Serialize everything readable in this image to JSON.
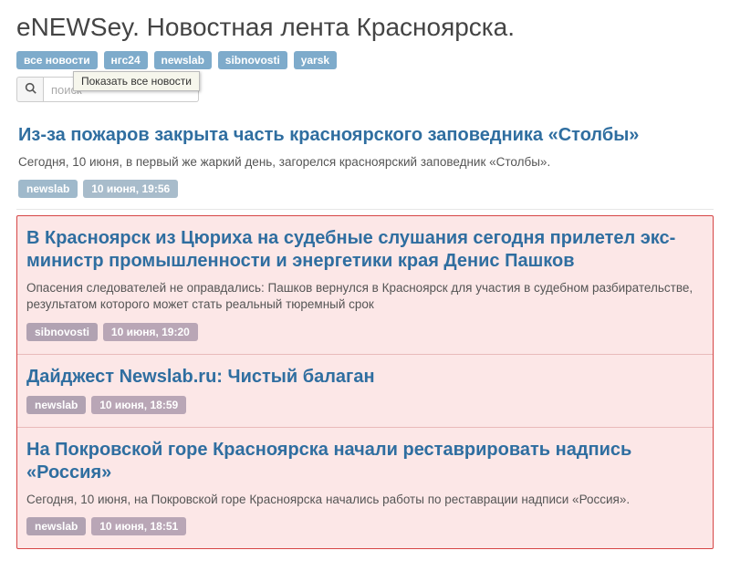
{
  "header": {
    "title": "eNEWSey. Новостная лента Красноярска."
  },
  "filters": {
    "items": [
      "все новости",
      "нгс24",
      "newslab",
      "sibnovosti",
      "yarsk"
    ]
  },
  "search": {
    "placeholder": "поиск"
  },
  "tooltip": {
    "text": "Показать все новости"
  },
  "articles": {
    "plain": {
      "title": "Из-за пожаров закрыта часть красноярского заповедника «Столбы»",
      "summary": "Сегодня, 10 июня, в первый же жаркий день, загорелся красноярский заповедник «Столбы».",
      "source": "newslab",
      "time": "10 июня, 19:56"
    },
    "highlighted": [
      {
        "title": "В Красноярск из Цюриха на судебные слушания сегодня прилетел экс-министр промышленности и энергетики края Денис Пашков",
        "summary": "Опасения следователей не оправдались: Пашков вернулся в Красноярск для участия в судебном разбирательстве, результатом которого может стать реальный тюремный срок",
        "source": "sibnovosti",
        "time": "10 июня, 19:20"
      },
      {
        "title": "Дайджест Newslab.ru: Чистый балаган",
        "summary": "",
        "source": "newslab",
        "time": "10 июня, 18:59"
      },
      {
        "title": "На Покровской горе Красноярска начали реставрировать надпись «Россия»",
        "summary": "Сегодня, 10 июня, на Покровской горе Красноярска начались работы по реставрации надписи «Россия».",
        "source": "newslab",
        "time": "10 июня, 18:51"
      }
    ]
  }
}
